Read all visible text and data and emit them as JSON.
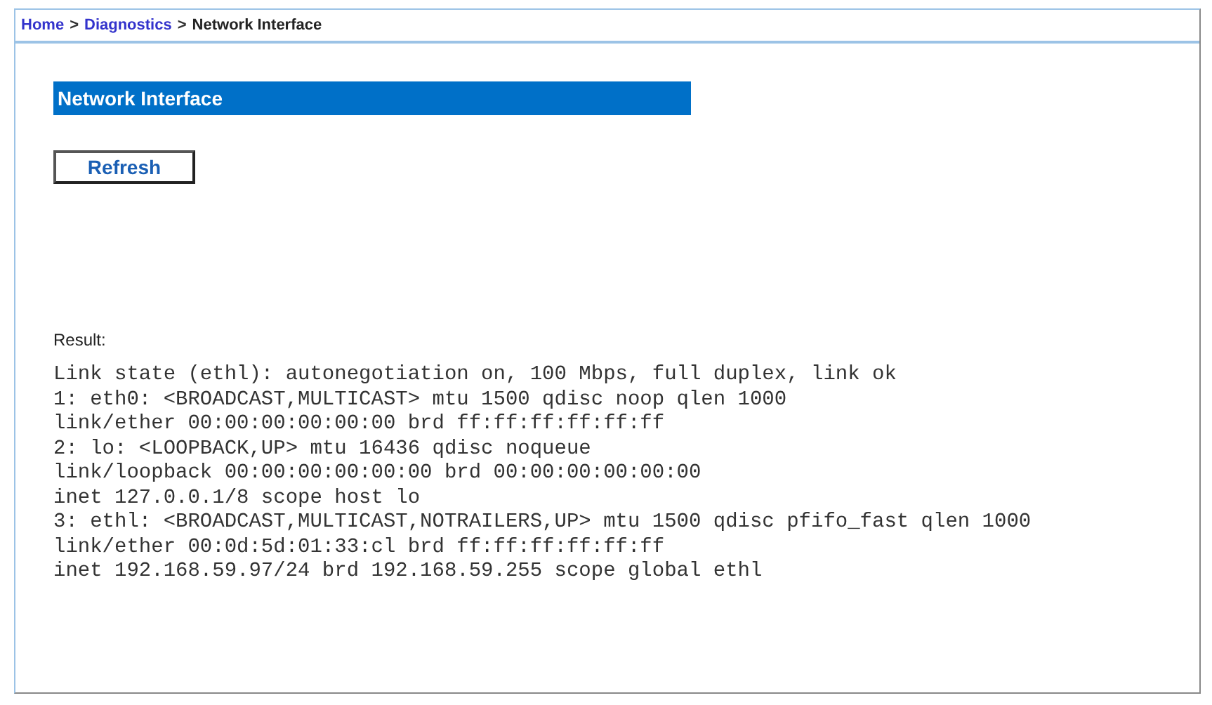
{
  "breadcrumb": [
    {
      "label": "Home",
      "kind": "link"
    },
    {
      "label": ">",
      "kind": "separator"
    },
    {
      "label": "Diagnostics",
      "kind": "link"
    },
    {
      "label": ">",
      "kind": "separator"
    },
    {
      "label": "Network Interface",
      "kind": "current"
    }
  ],
  "section_title": "Network Interface",
  "refresh_button": "Refresh",
  "result_label": "Result:",
  "output_lines": [
    "Link state (ethl): autonegotiation on, 100 Mbps, full duplex, link ok",
    "1: eth0: <BROADCAST,MULTICAST> mtu 1500 qdisc noop qlen 1000",
    "link/ether 00:00:00:00:00:00 brd ff:ff:ff:ff:ff:ff",
    "2: lo: <LOOPBACK,UP> mtu 16436 qdisc noqueue",
    "link/loopback 00:00:00:00:00:00 brd 00:00:00:00:00:00",
    "inet 127.0.0.1/8 scope host lo",
    "3: ethl: <BROADCAST,MULTICAST,NOTRAILERS,UP> mtu 1500 qdisc pfifo_fast qlen 1000",
    "link/ether 00:0d:5d:01:33:cl brd ff:ff:ff:ff:ff:ff",
    "inet 192.168.59.97/24 brd 192.168.59.255 scope global ethl"
  ]
}
